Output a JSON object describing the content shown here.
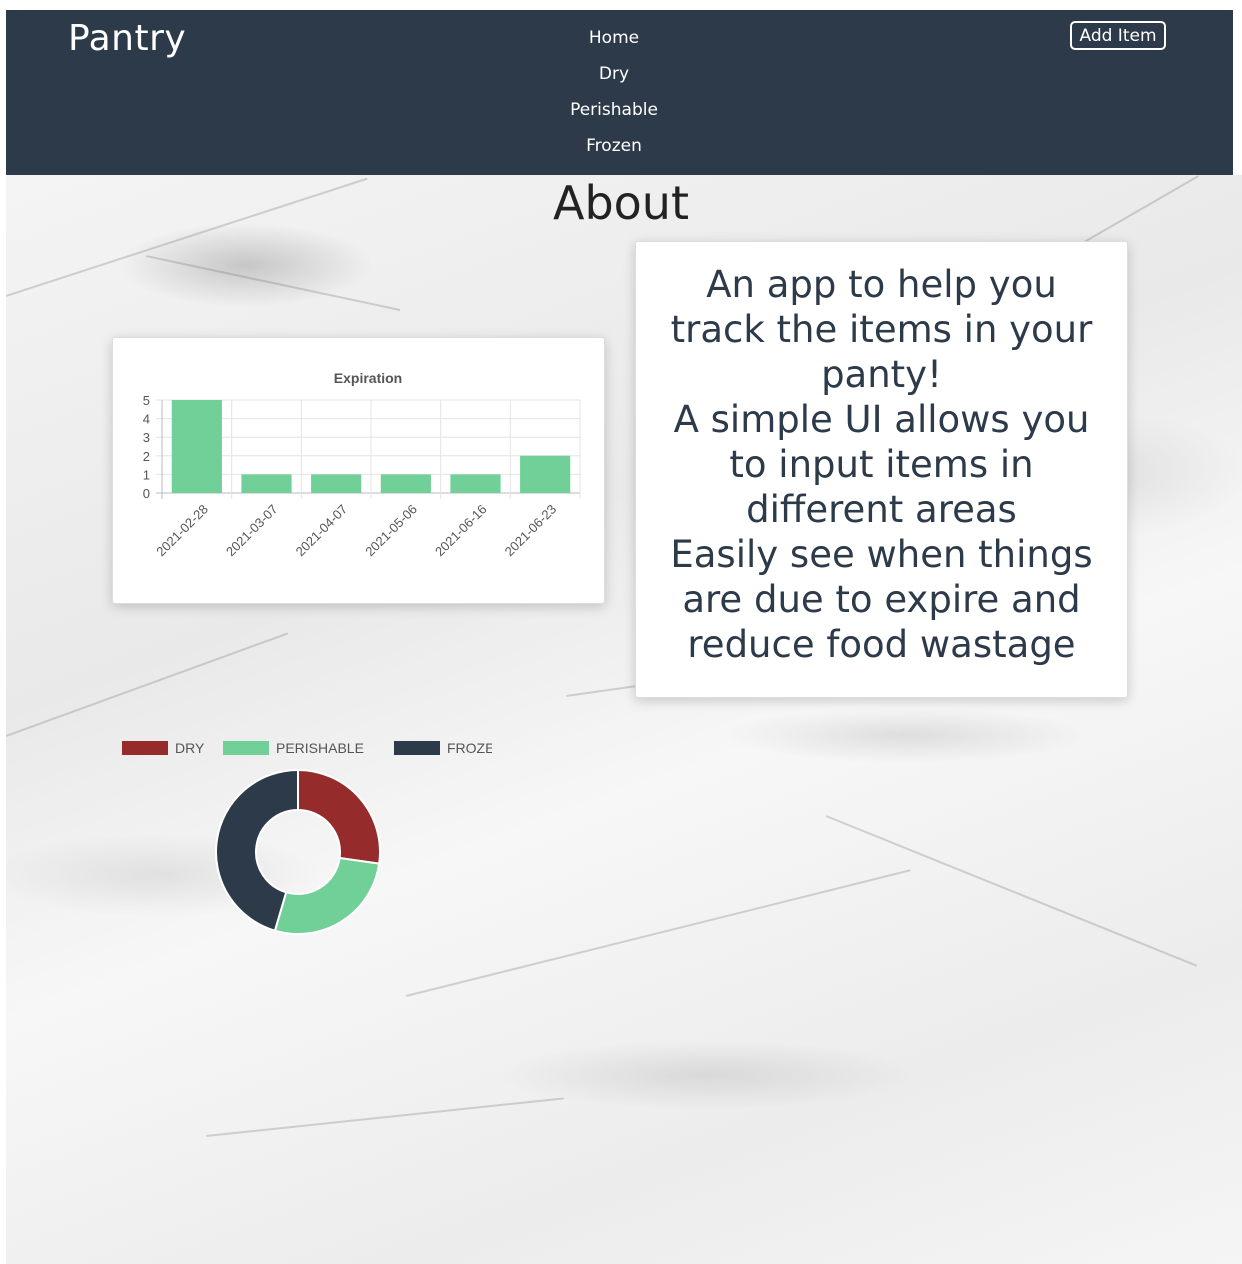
{
  "navbar": {
    "brand": "Pantry",
    "links": [
      {
        "label": "Home"
      },
      {
        "label": "Dry"
      },
      {
        "label": "Perishable"
      },
      {
        "label": "Frozen"
      }
    ],
    "add_button": "Add Item",
    "background": "#2d3a4a"
  },
  "page": {
    "title": "About"
  },
  "about": {
    "lines": [
      "An app to help you track the items in your panty!",
      "A simple UI allows you to input items in different areas",
      "Easily see when things are due to expire and reduce food wastage"
    ]
  },
  "chart_data": [
    {
      "type": "bar",
      "title": "Expiration",
      "categories": [
        "2021-02-28",
        "2021-03-07",
        "2021-04-07",
        "2021-05-06",
        "2021-06-16",
        "2021-06-23"
      ],
      "values": [
        5,
        1,
        1,
        1,
        1,
        2
      ],
      "ylim": [
        0,
        5
      ],
      "yticks": [
        0,
        1,
        2,
        3,
        4,
        5
      ],
      "grid": true,
      "color": "#71cf98"
    },
    {
      "type": "pie",
      "variant": "doughnut",
      "categories": [
        "DRY",
        "PERISHABLE",
        "FROZEN"
      ],
      "values": [
        3,
        3,
        5
      ],
      "colors": [
        "#952b2b",
        "#71cf98",
        "#2d3a4a"
      ],
      "legend": "top"
    }
  ]
}
